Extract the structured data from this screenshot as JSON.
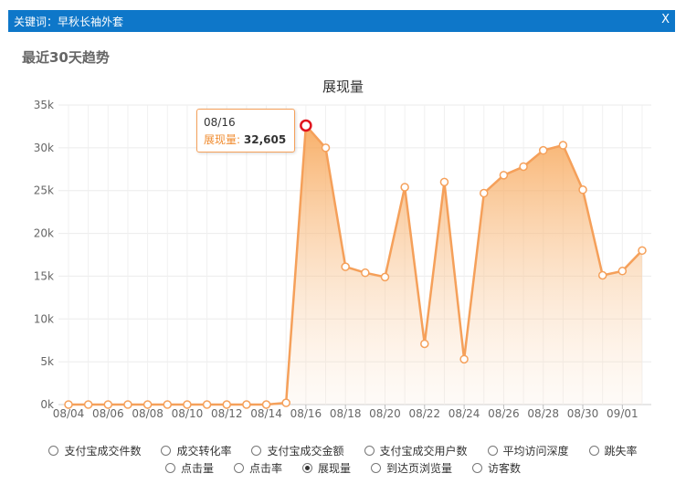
{
  "window": {
    "title": "关键词：早秋长袖外套",
    "close_label": "X"
  },
  "section_title": "最近30天趋势",
  "tooltip": {
    "date": "08/16",
    "label": "展现量:",
    "value": "32,605"
  },
  "legend": {
    "row1": [
      "支付宝成交件数",
      "成交转化率",
      "支付宝成交金额",
      "支付宝成交用户数",
      "平均访问深度",
      "跳失率"
    ],
    "row2": [
      "点击量",
      "点击率",
      "展现量",
      "到达页浏览量",
      "访客数"
    ],
    "selected": "展现量"
  },
  "chart_data": {
    "type": "area",
    "title": "展现量",
    "xlabel": "",
    "ylabel": "",
    "ylim": [
      0,
      35000
    ],
    "grid": true,
    "yticks": [
      "0k",
      "5k",
      "10k",
      "15k",
      "20k",
      "25k",
      "30k",
      "35k"
    ],
    "xtick_labels": [
      "08/04",
      "08/06",
      "08/08",
      "08/10",
      "08/12",
      "08/14",
      "08/16",
      "08/18",
      "08/20",
      "08/22",
      "08/24",
      "08/26",
      "08/28",
      "08/30",
      "09/01"
    ],
    "x": [
      "08/04",
      "08/05",
      "08/06",
      "08/07",
      "08/08",
      "08/09",
      "08/10",
      "08/11",
      "08/12",
      "08/13",
      "08/14",
      "08/15",
      "08/16",
      "08/17",
      "08/18",
      "08/19",
      "08/20",
      "08/21",
      "08/22",
      "08/23",
      "08/24",
      "08/25",
      "08/26",
      "08/27",
      "08/28",
      "08/29",
      "08/30",
      "08/31",
      "09/01",
      "09/02"
    ],
    "series": [
      {
        "name": "展现量",
        "color": "#f5a05a",
        "values": [
          0,
          0,
          0,
          0,
          0,
          0,
          0,
          0,
          0,
          0,
          0,
          200,
          32605,
          30000,
          16100,
          15400,
          14900,
          25400,
          7100,
          26000,
          5300,
          24700,
          26800,
          27800,
          29700,
          30300,
          25100,
          15100,
          15600,
          18000
        ]
      }
    ],
    "highlighted_point": "08/16"
  }
}
